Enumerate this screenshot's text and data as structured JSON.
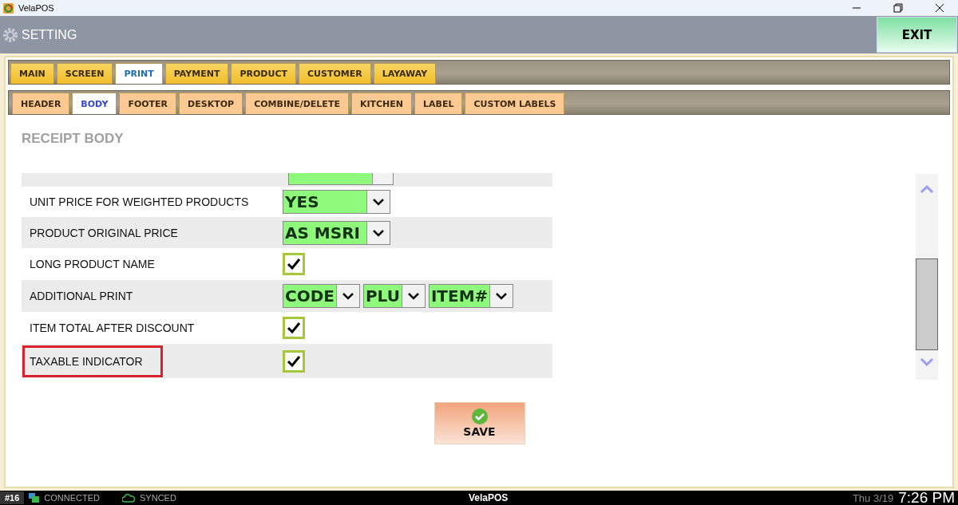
{
  "window": {
    "title": "VelaPOS"
  },
  "header": {
    "title": "SETTING",
    "exit_button": "EXIT"
  },
  "tabs": [
    {
      "label": "MAIN",
      "selected": false
    },
    {
      "label": "SCREEN",
      "selected": false
    },
    {
      "label": "PRINT",
      "selected": true
    },
    {
      "label": "PAYMENT",
      "selected": false
    },
    {
      "label": "PRODUCT",
      "selected": false
    },
    {
      "label": "CUSTOMER",
      "selected": false
    },
    {
      "label": "LAYAWAY",
      "selected": false
    }
  ],
  "subtabs": [
    {
      "label": "HEADER",
      "selected": false
    },
    {
      "label": "BODY",
      "selected": true
    },
    {
      "label": "FOOTER",
      "selected": false
    },
    {
      "label": "DESKTOP",
      "selected": false
    },
    {
      "label": "COMBINE/DELETE",
      "selected": false
    },
    {
      "label": "KITCHEN",
      "selected": false
    },
    {
      "label": "LABEL",
      "selected": false
    },
    {
      "label": "CUSTOM LABELS",
      "selected": false
    }
  ],
  "section_title": "RECEIPT BODY",
  "settings": [
    {
      "kind": "partial"
    },
    {
      "kind": "select",
      "label": "UNIT PRICE FOR WEIGHTED PRODUCTS",
      "value": "YES",
      "highlighted": false
    },
    {
      "kind": "select",
      "label": "PRODUCT ORIGINAL PRICE",
      "value": "AS MSRI",
      "highlighted": false
    },
    {
      "kind": "checkbox",
      "label": "LONG PRODUCT NAME",
      "checked": true,
      "highlighted": false
    },
    {
      "kind": "multi",
      "label": "ADDITIONAL PRINT",
      "values": [
        "CODE",
        "PLU",
        "ITEM#"
      ],
      "highlighted": false
    },
    {
      "kind": "checkbox",
      "label": "ITEM TOTAL AFTER DISCOUNT",
      "checked": true,
      "highlighted": false
    },
    {
      "kind": "checkbox",
      "label": "TAXABLE INDICATOR",
      "checked": true,
      "highlighted": true
    }
  ],
  "save_button": "SAVE",
  "status_bar": {
    "terminal": "#16",
    "connection": "CONNECTED",
    "sync": "SYNCED",
    "brand": "VelaPOS",
    "date": "Thu 3/19",
    "time": "7:26 PM"
  }
}
